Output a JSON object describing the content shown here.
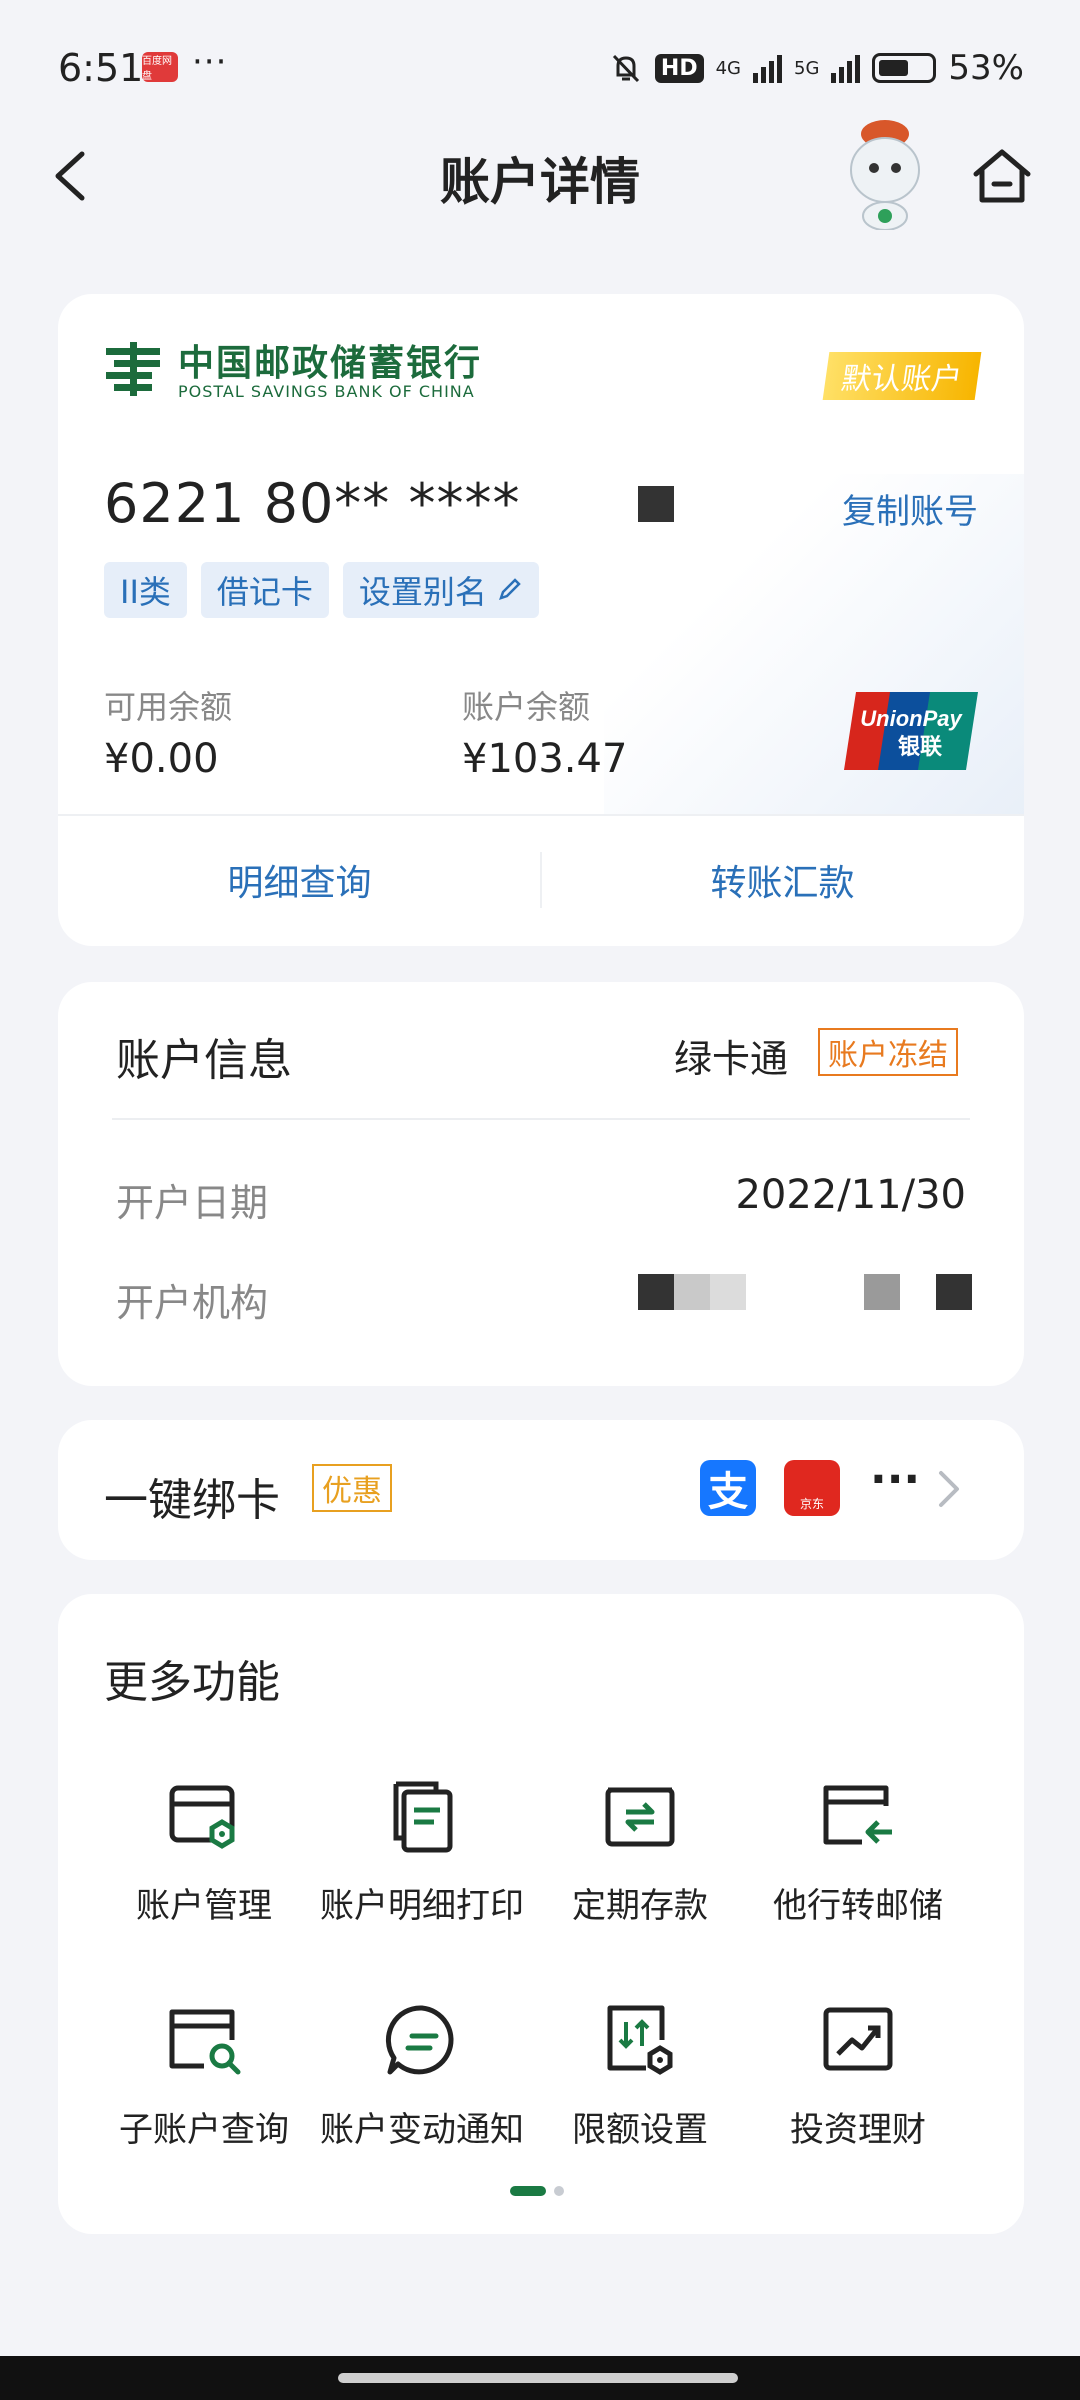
{
  "status_bar": {
    "time": "6:51",
    "notification_app": "百度网盘",
    "more": "···",
    "hd": "HD",
    "net_4g": "4G",
    "net_5g": "5G",
    "battery": "53%"
  },
  "header": {
    "title": "账户详情",
    "back_icon": "chevron-left-icon",
    "mascot_icon": "mascot-icon",
    "home_icon": "home-icon"
  },
  "account_card": {
    "bank_name_cn": "中国邮政储蓄银行",
    "bank_name_en": "POSTAL SAVINGS BANK OF CHINA",
    "default_badge": "默认账户",
    "card_number": "6221 80** ****",
    "copy_link": "复制账号",
    "tags": [
      "II类",
      "借记卡",
      "设置别名"
    ],
    "available_label": "可用余额",
    "available_value": "¥0.00",
    "balance_label": "账户余额",
    "balance_value": "¥103.47",
    "card_network": "UnionPay 银联",
    "actions": [
      "明细查询",
      "转账汇款"
    ],
    "colors": {
      "green": "#1c6b3c",
      "link": "#2a70b8",
      "badge": "#f7b500"
    }
  },
  "account_info": {
    "title": "账户信息",
    "card_type": "绿卡通",
    "status_badge": "账户冻结",
    "rows": [
      {
        "label": "开户日期",
        "value": "2022/11/30"
      },
      {
        "label": "开户机构",
        "value": ""
      }
    ],
    "colors": {
      "status": "#e87a1f"
    }
  },
  "quick_bind": {
    "title": "一键绑卡",
    "promo_badge": "优惠",
    "partners": [
      "alipay-icon",
      "jd-icon"
    ],
    "alipay_glyph": "支",
    "jd_label": "京东",
    "more": "···"
  },
  "more_functions": {
    "title": "更多功能",
    "items": [
      {
        "label": "账户管理",
        "icon": "account-settings-icon"
      },
      {
        "label": "账户明细打印",
        "icon": "document-print-icon"
      },
      {
        "label": "定期存款",
        "icon": "fixed-deposit-icon"
      },
      {
        "label": "他行转邮储",
        "icon": "transfer-in-icon"
      },
      {
        "label": "子账户查询",
        "icon": "sub-account-search-icon"
      },
      {
        "label": "账户变动通知",
        "icon": "notification-chat-icon"
      },
      {
        "label": "限额设置",
        "icon": "limit-settings-icon"
      },
      {
        "label": "投资理财",
        "icon": "investment-chart-icon"
      }
    ],
    "page": 1,
    "page_count": 2
  }
}
